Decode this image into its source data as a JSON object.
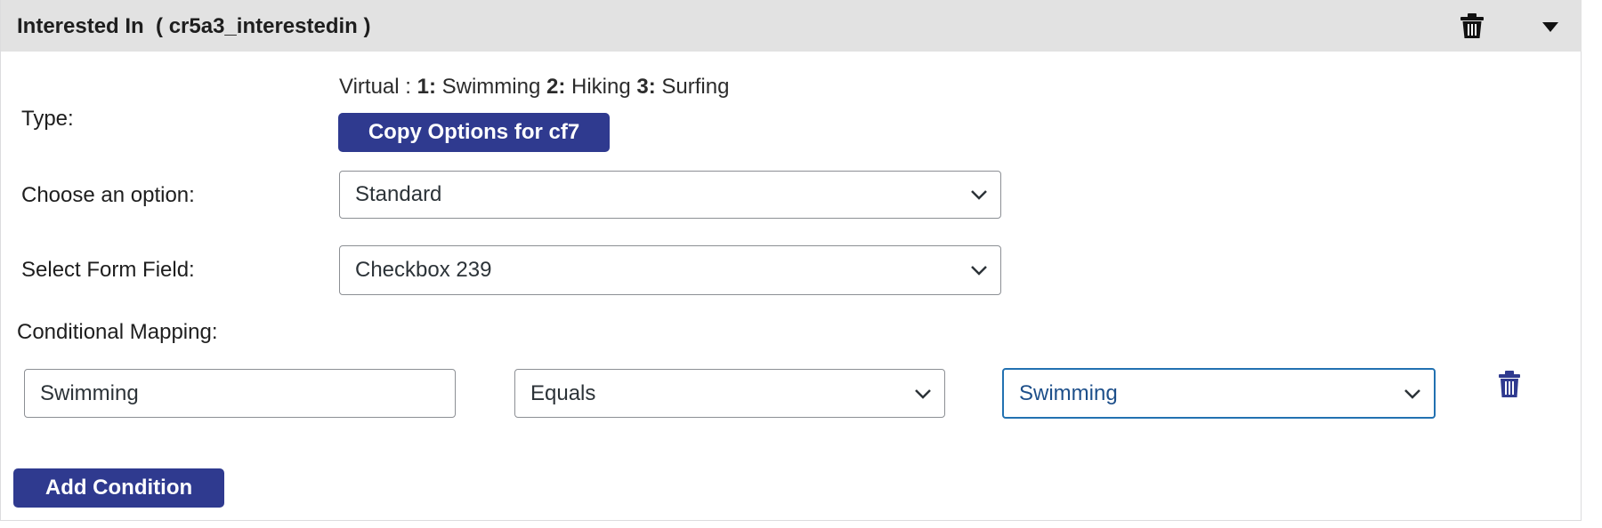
{
  "header": {
    "title": "Interested In  ( cr5a3_interestedin )",
    "delete_icon": "trash-icon",
    "toggle_icon": "caret-down-icon"
  },
  "type_row": {
    "label": "Type:",
    "hint_prefix": "Virtual : ",
    "options": [
      {
        "num": "1:",
        "text": " Swimming "
      },
      {
        "num": "2:",
        "text": " Hiking "
      },
      {
        "num": "3:",
        "text": " Surfing"
      }
    ],
    "copy_button": "Copy Options for cf7"
  },
  "option_row": {
    "label": "Choose an option:",
    "value": "Standard"
  },
  "field_row": {
    "label": "Select Form Field:",
    "value": "Checkbox 239"
  },
  "conditional": {
    "label": "Conditional Mapping:",
    "rows": [
      {
        "input_value": "Swimming",
        "operator": "Equals",
        "target": "Swimming",
        "delete_icon": "trash-icon"
      }
    ],
    "add_button": "Add Condition"
  },
  "colors": {
    "header_bg": "#e2e2e2",
    "button_bg": "#2f3a8f",
    "focus_border": "#2271b1"
  }
}
